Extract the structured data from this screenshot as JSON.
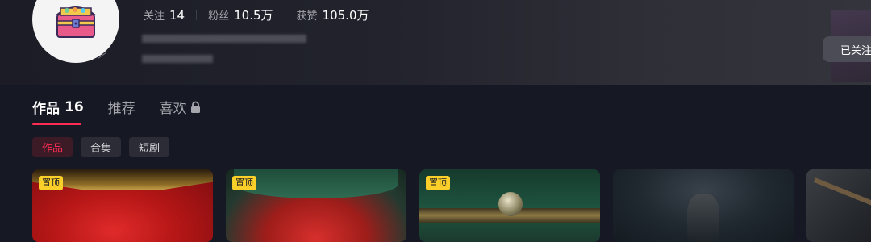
{
  "profile": {
    "stats": [
      {
        "label": "关注",
        "value": "14"
      },
      {
        "label": "粉丝",
        "value": "10.5万"
      },
      {
        "label": "获赞",
        "value": "105.0万"
      }
    ],
    "follow_button": "已关注"
  },
  "tabs": [
    {
      "label": "作品",
      "count": "16",
      "active": true
    },
    {
      "label": "推荐",
      "active": false
    },
    {
      "label": "喜欢",
      "locked": true,
      "active": false
    }
  ],
  "filters": [
    {
      "label": "作品",
      "active": true
    },
    {
      "label": "合集",
      "active": false
    },
    {
      "label": "短剧",
      "active": false
    }
  ],
  "videos": [
    {
      "pinned": true,
      "badge": "置顶"
    },
    {
      "pinned": true,
      "badge": "置顶"
    },
    {
      "pinned": true,
      "badge": "置顶"
    },
    {
      "pinned": false
    },
    {
      "pinned": false
    }
  ],
  "icons": {
    "avatar": "treasure-chest-icon",
    "lock": "lock-icon"
  },
  "colors": {
    "background": "#161823",
    "accent": "#fe2c55",
    "pin_badge": "#facf2a",
    "follow_button": "#4b4c55"
  }
}
